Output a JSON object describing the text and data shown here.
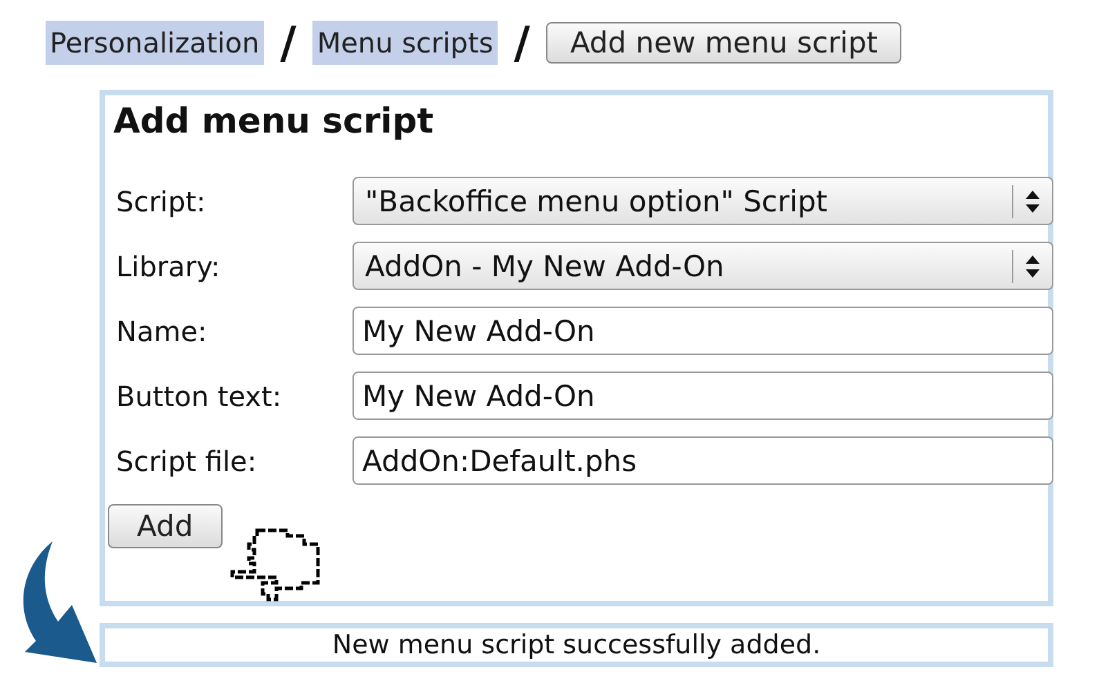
{
  "breadcrumb": {
    "links": [
      "Personalization",
      "Menu scripts"
    ],
    "separator": "/",
    "button": "Add new menu script"
  },
  "panel": {
    "title": "Add menu script",
    "fields": [
      {
        "label": "Script:",
        "kind": "select",
        "value": "\"Backoffice menu option\" Script"
      },
      {
        "label": "Library:",
        "kind": "select",
        "value": "AddOn - My New Add-On"
      },
      {
        "label": "Name:",
        "kind": "text",
        "value": "My New Add-On"
      },
      {
        "label": "Button text:",
        "kind": "text",
        "value": "My New Add-On"
      },
      {
        "label": "Script file:",
        "kind": "text",
        "value": "AddOn:Default.phs"
      }
    ],
    "submit": "Add"
  },
  "message": "New menu script successfully added."
}
